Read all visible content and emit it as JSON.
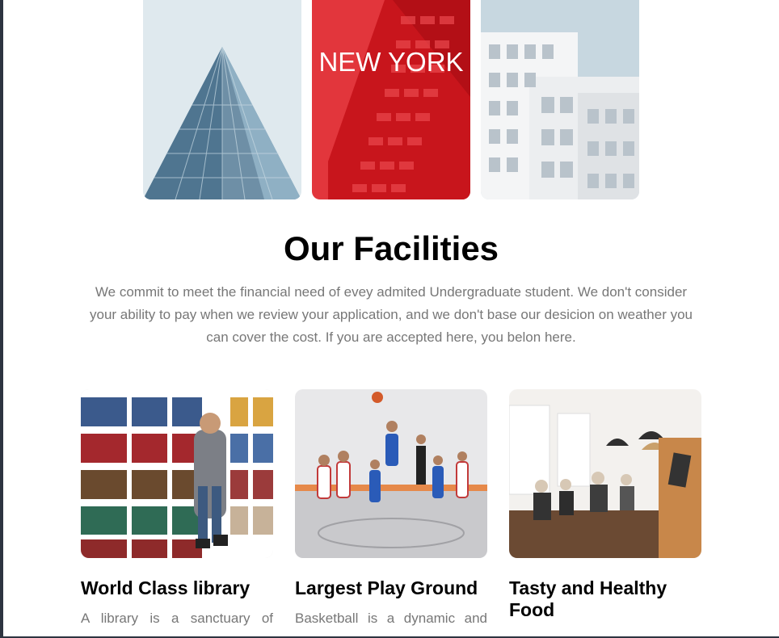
{
  "gallery": {
    "tiles": [
      {
        "label": ""
      },
      {
        "label": "NEW YORK"
      },
      {
        "label": ""
      }
    ]
  },
  "facilities": {
    "title": "Our Facilities",
    "intro": "We commit to meet the financial need of evey admited Undergraduate student. We don't consider your ability to pay when we review your application, and we don't base our desicion on weather you can cover the cost. If you are accepted here, you belon here.",
    "cards": [
      {
        "title": "World Class library",
        "text": "A library is a sanctuary of"
      },
      {
        "title": "Largest Play Ground",
        "text": "Basketball is a dynamic and"
      },
      {
        "title": "Tasty and Healthy Food",
        "text": ""
      }
    ]
  },
  "colors": {
    "accent_red": "#d8262b",
    "body_text": "#777777",
    "heading": "#000000"
  }
}
